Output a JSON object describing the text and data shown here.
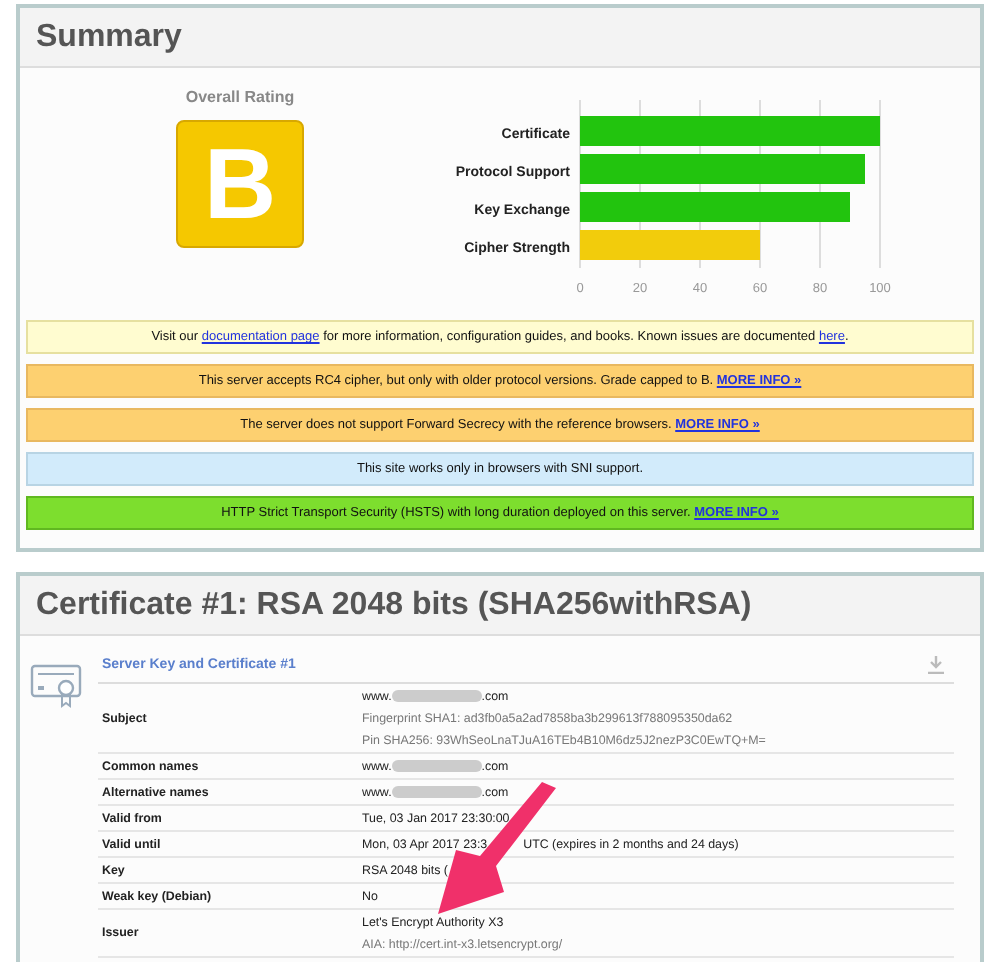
{
  "summary": {
    "title": "Summary",
    "rating_label": "Overall Rating",
    "grade": "B",
    "chart_data": {
      "type": "bar",
      "orientation": "horizontal",
      "stacked": true,
      "categories": [
        "Certificate",
        "Protocol Support",
        "Key Exchange",
        "Cipher Strength"
      ],
      "series": [
        {
          "color": "#22c40e",
          "values": [
            100,
            95,
            90,
            null
          ]
        },
        {
          "color": "#f2cc0c",
          "values": [
            null,
            null,
            null,
            60
          ]
        }
      ],
      "grid": true,
      "xlim": [
        0,
        100
      ],
      "xticks": [
        0,
        20,
        40,
        60,
        80,
        100
      ]
    },
    "notices": [
      {
        "kind": "info",
        "parts": [
          "Visit our ",
          "documentation page",
          " for more information, configuration guides, and books. Known issues are documented ",
          "here",
          "."
        ]
      },
      {
        "kind": "warning",
        "parts": [
          "This server accepts RC4 cipher, but only with older protocol versions. Grade capped to B.  ",
          "MORE INFO »"
        ]
      },
      {
        "kind": "warning",
        "parts": [
          "The server does not support Forward Secrecy with the reference browsers.  ",
          "MORE INFO »"
        ]
      },
      {
        "kind": "note",
        "parts": [
          "This site works only in browsers with SNI support."
        ]
      },
      {
        "kind": "good",
        "parts": [
          "HTTP Strict Transport Security (HSTS) with long duration deployed on this server.  ",
          "MORE INFO »"
        ]
      }
    ]
  },
  "certificate": {
    "title": "Certificate #1: RSA 2048 bits (SHA256withRSA)",
    "section_title": "Server Key and Certificate #1",
    "rows": [
      {
        "label": "Subject",
        "lines": [
          {
            "kind": "redacted",
            "parts": [
              "www.",
              ".com"
            ]
          },
          {
            "kind": "muted",
            "parts": [
              "Fingerprint SHA1: ad3fb0a5a2ad7858ba3b299613f788095350da62"
            ]
          },
          {
            "kind": "muted",
            "parts": [
              "Pin SHA256: 93WhSeoLnaTJuA16TEb4B10M6dz5J2nezP3C0EwTQ+M="
            ]
          }
        ]
      },
      {
        "label": "Common names",
        "lines": [
          {
            "kind": "redacted",
            "parts": [
              "www.",
              ".com"
            ]
          }
        ]
      },
      {
        "label": "Alternative names",
        "lines": [
          {
            "kind": "redacted",
            "parts": [
              "www.",
              ".com"
            ]
          }
        ]
      },
      {
        "label": "Valid from",
        "lines": [
          {
            "kind": "split",
            "parts": [
              "Tue, 03 Jan 2017 23:30:00"
            ]
          }
        ]
      },
      {
        "label": "Valid until",
        "lines": [
          {
            "kind": "split",
            "parts": [
              "Mon, 03 Apr 2017 23:3",
              "UTC (expires in 2 months and 24 days)"
            ]
          }
        ]
      },
      {
        "label": "Key",
        "lines": [
          {
            "kind": "split",
            "parts": [
              "RSA 2048 bits ("
            ]
          }
        ]
      },
      {
        "label": "Weak key (Debian)",
        "lines": [
          {
            "kind": "plain",
            "parts": [
              "No"
            ]
          }
        ]
      },
      {
        "label": "Issuer",
        "lines": [
          {
            "kind": "plain",
            "parts": [
              "Let's Encrypt Authority X3"
            ]
          },
          {
            "kind": "muted",
            "parts": [
              "AIA: http://cert.int-x3.letsencrypt.org/"
            ]
          }
        ]
      }
    ]
  }
}
